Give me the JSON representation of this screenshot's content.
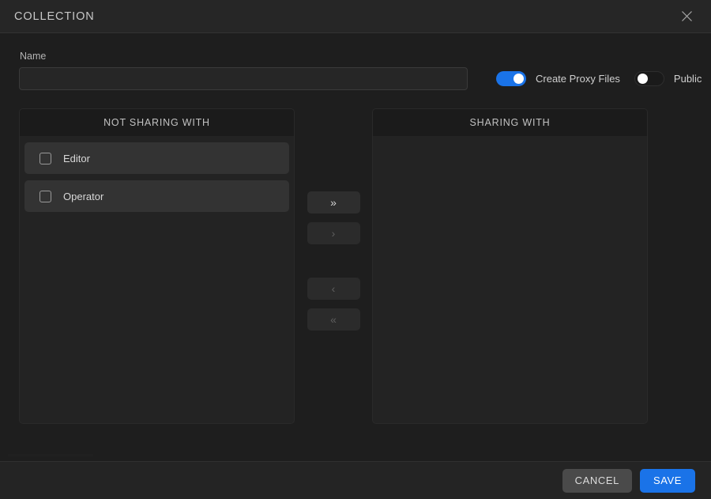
{
  "dialog": {
    "title": "COLLECTION",
    "close_icon": "close-icon"
  },
  "form": {
    "name_label": "Name",
    "name_value": "",
    "name_placeholder": ""
  },
  "toggles": [
    {
      "label": "Create Proxy Files",
      "state": "on",
      "color": "#1a73e8"
    },
    {
      "label": "Public",
      "state": "off",
      "color": "#1a1a1a"
    }
  ],
  "transfer": {
    "left_panel": {
      "header": "NOT SHARING WITH",
      "items": [
        {
          "label": "Editor",
          "checked": false
        },
        {
          "label": "Operator",
          "checked": false
        }
      ]
    },
    "right_panel": {
      "header": "SHARING WITH",
      "items": []
    },
    "buttons": [
      {
        "name": "move-all-right-button",
        "glyph": "»",
        "enabled": true
      },
      {
        "name": "move-right-button",
        "glyph": "›",
        "enabled": false
      },
      {
        "name": "move-left-button",
        "glyph": "‹",
        "enabled": false
      },
      {
        "name": "move-all-left-button",
        "glyph": "«",
        "enabled": false
      }
    ]
  },
  "footer": {
    "cancel_label": "CANCEL",
    "save_label": "SAVE",
    "save_color": "#1a73e8"
  }
}
